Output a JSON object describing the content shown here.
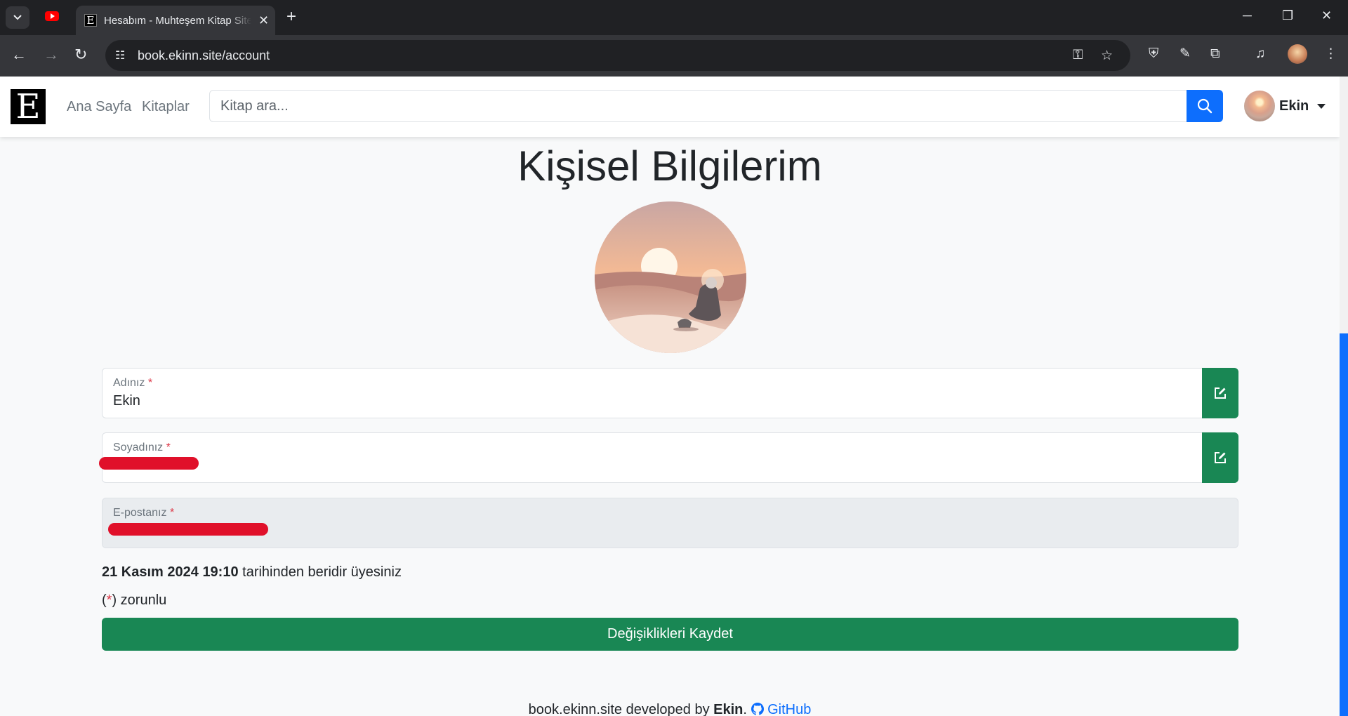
{
  "browser": {
    "tab_title": "Hesabım - Muhteşem Kitap Sitesi",
    "tab_favicon_letter": "E",
    "url": "book.ekinn.site/account"
  },
  "navbar": {
    "logo_letter": "E",
    "links": [
      "Ana Sayfa",
      "Kitaplar"
    ],
    "search_placeholder": "Kitap ara...",
    "user_name": "Ekin"
  },
  "main": {
    "title": "Kişisel Bilgilerim",
    "fields": {
      "first_name": {
        "label": "Adınız",
        "value": "Ekin"
      },
      "last_name": {
        "label": "Soyadınız",
        "value": ""
      },
      "email": {
        "label": "E-postanız",
        "value": ""
      }
    },
    "required_mark": "*",
    "member_since_date": "21 Kasım 2024 19:10",
    "member_since_suffix": " tarihinden beridir üyesiniz",
    "required_note_open": "(",
    "required_note_close": ") zorunlu",
    "save_button": "Değişiklikleri Kaydet"
  },
  "footer": {
    "prefix": "book.ekinn.site developed by ",
    "author": "Ekin",
    "separator": ".",
    "link": "GitHub"
  },
  "colors": {
    "primary": "#0d6efd",
    "success": "#198754",
    "danger": "#dc3545",
    "redaction": "#e0102a"
  }
}
